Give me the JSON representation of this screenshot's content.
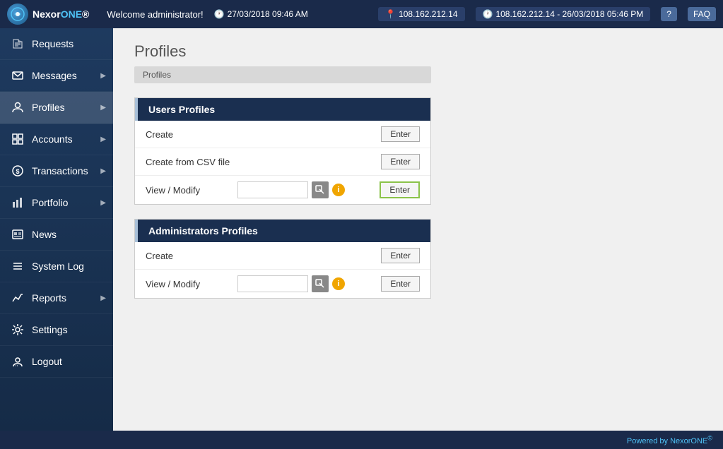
{
  "header": {
    "logo_text": "NexorONE",
    "logo_sup": "®",
    "welcome": "Welcome administrator!",
    "time_icon": "🕐",
    "time": "27/03/2018 09:46 AM",
    "ip_icon": "📍",
    "ip": "108.162.212.14",
    "session_icon": "🕐",
    "session": "108.162.212.14 - 26/03/2018 05:46 PM",
    "help_btn": "?",
    "faq_btn": "FAQ"
  },
  "sidebar": {
    "items": [
      {
        "label": "Requests",
        "icon": "↗",
        "has_arrow": false
      },
      {
        "label": "Messages",
        "icon": "✉",
        "has_arrow": true
      },
      {
        "label": "Profiles",
        "icon": "👤",
        "has_arrow": true,
        "active": true
      },
      {
        "label": "Accounts",
        "icon": "▦",
        "has_arrow": true
      },
      {
        "label": "Transactions",
        "icon": "💰",
        "has_arrow": true
      },
      {
        "label": "Portfolio",
        "icon": "📊",
        "has_arrow": true
      },
      {
        "label": "News",
        "icon": "📺",
        "has_arrow": false
      },
      {
        "label": "System Log",
        "icon": "≡",
        "has_arrow": false
      },
      {
        "label": "Reports",
        "icon": "📈",
        "has_arrow": true
      },
      {
        "label": "Settings",
        "icon": "⚙",
        "has_arrow": false
      },
      {
        "label": "Logout",
        "icon": "🔓",
        "has_arrow": false
      }
    ]
  },
  "content": {
    "page_title": "Profiles",
    "breadcrumb": "Profiles",
    "users_profiles_section": {
      "header": "Users Profiles",
      "rows": [
        {
          "label": "Create",
          "has_input": false,
          "btn": "Enter"
        },
        {
          "label": "Create from CSV file",
          "has_input": false,
          "btn": "Enter"
        },
        {
          "label": "View / Modify",
          "has_input": true,
          "btn": "Enter",
          "highlighted": true
        }
      ]
    },
    "admins_profiles_section": {
      "header": "Administrators Profiles",
      "rows": [
        {
          "label": "Create",
          "has_input": false,
          "btn": "Enter"
        },
        {
          "label": "View / Modify",
          "has_input": true,
          "btn": "Enter",
          "highlighted": false
        }
      ]
    }
  },
  "footer": {
    "text": "Powered by NexorONE",
    "sup": "©"
  }
}
